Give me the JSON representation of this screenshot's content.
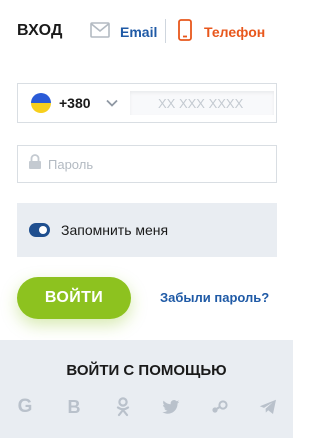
{
  "header": {
    "title": "ВХОД",
    "tabs": [
      {
        "label": "Email",
        "icon": "envelope-icon",
        "color": "#1f5aa6"
      },
      {
        "label": "Телефон",
        "icon": "phone-icon",
        "color": "#e8571c",
        "active": true
      }
    ]
  },
  "phone": {
    "country_code": "+380",
    "country_flag": "ukraine-flag-icon",
    "placeholder": "XX XXX XXXX"
  },
  "password": {
    "placeholder": "Пароль"
  },
  "remember": {
    "label": "Запомнить меня",
    "checked": true
  },
  "actions": {
    "login_label": "ВОЙТИ",
    "forgot_label": "Забыли пароль?"
  },
  "social": {
    "title": "ВОЙТИ С ПОМОЩЬЮ",
    "icons": [
      {
        "name": "google-icon",
        "glyph": "G"
      },
      {
        "name": "vk-icon",
        "glyph": "B"
      },
      {
        "name": "odnoklassniki-icon",
        "glyph": ""
      },
      {
        "name": "twitter-icon",
        "glyph": ""
      },
      {
        "name": "steam-icon",
        "glyph": ""
      },
      {
        "name": "telegram-icon",
        "glyph": ""
      }
    ]
  },
  "colors": {
    "accent_blue": "#1f5aa6",
    "accent_orange": "#e8571c",
    "primary_green": "#8dc21f",
    "panel_gray": "#e9edf2"
  }
}
